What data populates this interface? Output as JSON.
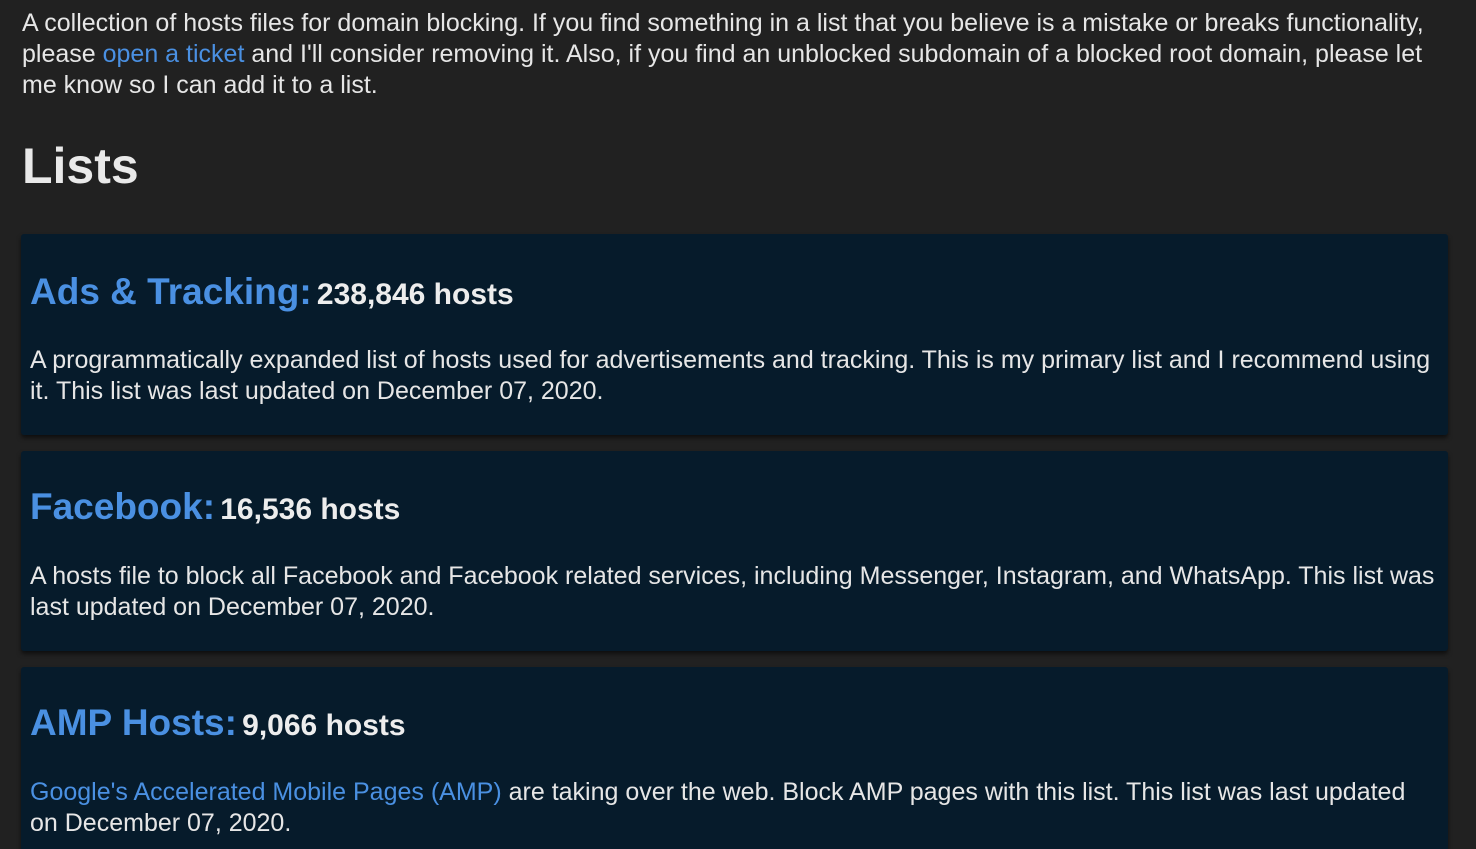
{
  "intro": {
    "before_link": "A collection of hosts files for domain blocking. If you find something in a list that you believe is a mistake or breaks functionality, please ",
    "link_text": "open a ticket",
    "after_link": " and I'll consider removing it. Also, if you find an unblocked subdomain of a blocked root domain, please let me know so I can add it to a list."
  },
  "section_title": "Lists",
  "lists": [
    {
      "name": "Ads & Tracking:",
      "count": "238,846 hosts",
      "desc_link": "",
      "description": "A programmatically expanded list of hosts used for advertisements and tracking. This is my primary list and I recommend using it. This list was last updated on December 07, 2020."
    },
    {
      "name": "Facebook:",
      "count": "16,536 hosts",
      "desc_link": "",
      "description": "A hosts file to block all Facebook and Facebook related services, including Messenger, Instagram, and WhatsApp. This list was last updated on December 07, 2020."
    },
    {
      "name": "AMP Hosts:",
      "count": "9,066 hosts",
      "desc_link": "Google's Accelerated Mobile Pages (AMP)",
      "description": " are taking over the web. Block AMP pages with this list. This list was last updated on December 07, 2020."
    }
  ],
  "colors": {
    "background": "#212121",
    "card_background": "#061b2b",
    "link": "#4a90e2",
    "text": "#e6e6e6"
  }
}
